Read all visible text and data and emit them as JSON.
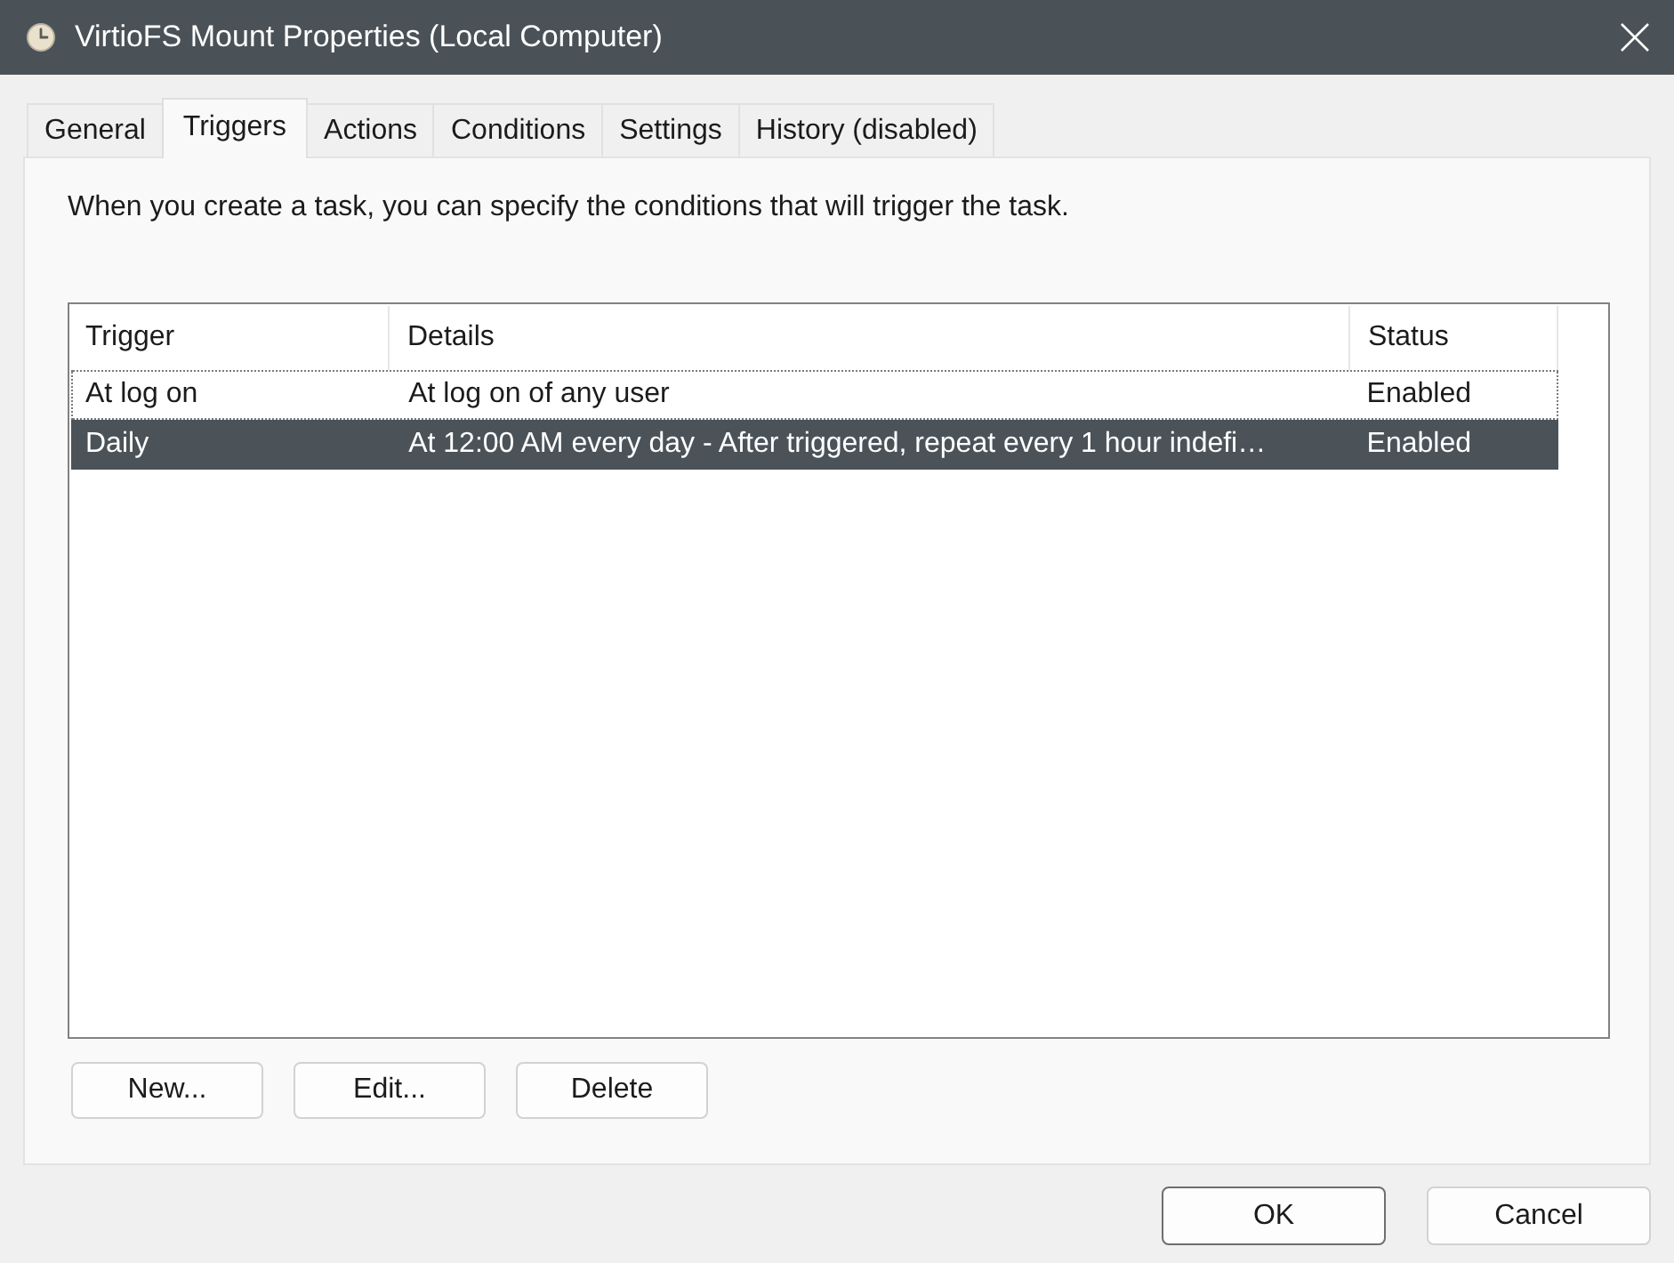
{
  "window": {
    "title": "VirtioFS Mount Properties (Local Computer)"
  },
  "tabs": [
    {
      "label": "General",
      "selected": false
    },
    {
      "label": "Triggers",
      "selected": true
    },
    {
      "label": "Actions",
      "selected": false
    },
    {
      "label": "Conditions",
      "selected": false
    },
    {
      "label": "Settings",
      "selected": false
    },
    {
      "label": "History (disabled)",
      "selected": false
    }
  ],
  "description": "When you create a task, you can specify the conditions that will trigger the task.",
  "table": {
    "columns": [
      "Trigger",
      "Details",
      "Status"
    ],
    "rows": [
      {
        "cells": [
          "At log on",
          "At log on of any user",
          "Enabled"
        ],
        "selected": false,
        "focused": true
      },
      {
        "cells": [
          "Daily",
          "At 12:00 AM every day - After triggered, repeat every 1 hour indefi…",
          "Enabled"
        ],
        "selected": true,
        "focused": false
      }
    ]
  },
  "table_buttons": [
    "New...",
    "Edit...",
    "Delete"
  ],
  "dialog_buttons": [
    {
      "label": "OK",
      "default": true
    },
    {
      "label": "Cancel",
      "default": false
    }
  ]
}
